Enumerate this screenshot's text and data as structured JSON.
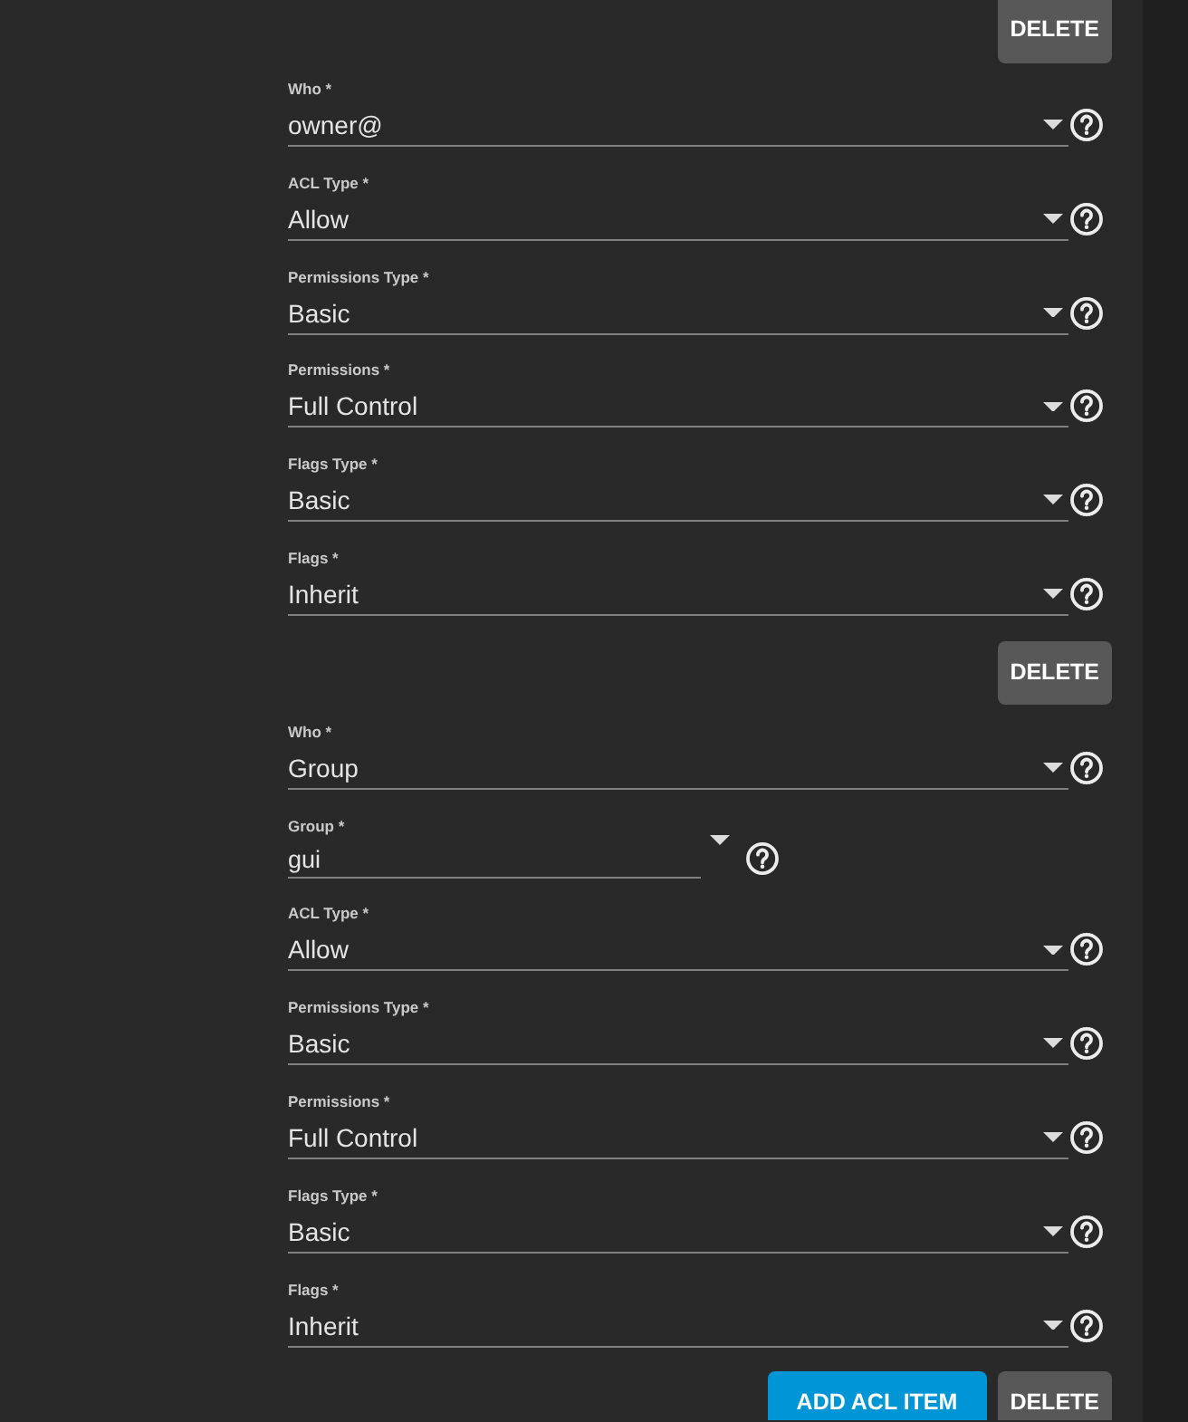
{
  "previous_item": {
    "buttons": [
      {
        "kind": "delete",
        "label": "DELETE"
      }
    ]
  },
  "acl_items": [
    {
      "fields": [
        {
          "kind": "select",
          "label": "Who *",
          "value": "owner@"
        },
        {
          "kind": "select",
          "label": "ACL Type *",
          "value": "Allow"
        },
        {
          "kind": "select",
          "label": "Permissions Type *",
          "value": "Basic"
        },
        {
          "kind": "select",
          "label": "Permissions *",
          "value": "Full Control"
        },
        {
          "kind": "select",
          "label": "Flags Type *",
          "value": "Basic"
        },
        {
          "kind": "select",
          "label": "Flags *",
          "value": "Inherit"
        }
      ],
      "buttons": [
        {
          "kind": "delete",
          "label": "DELETE"
        }
      ]
    },
    {
      "fields": [
        {
          "kind": "select",
          "label": "Who *",
          "value": "Group"
        },
        {
          "kind": "combobox",
          "label": "Group *",
          "value": "gui"
        },
        {
          "kind": "select",
          "label": "ACL Type *",
          "value": "Allow"
        },
        {
          "kind": "select",
          "label": "Permissions Type *",
          "value": "Basic"
        },
        {
          "kind": "select",
          "label": "Permissions *",
          "value": "Full Control"
        },
        {
          "kind": "select",
          "label": "Flags Type *",
          "value": "Basic"
        },
        {
          "kind": "select",
          "label": "Flags *",
          "value": "Inherit"
        }
      ],
      "buttons": [
        {
          "kind": "add",
          "label": "ADD ACL ITEM"
        },
        {
          "kind": "delete",
          "label": "DELETE"
        }
      ]
    }
  ]
}
